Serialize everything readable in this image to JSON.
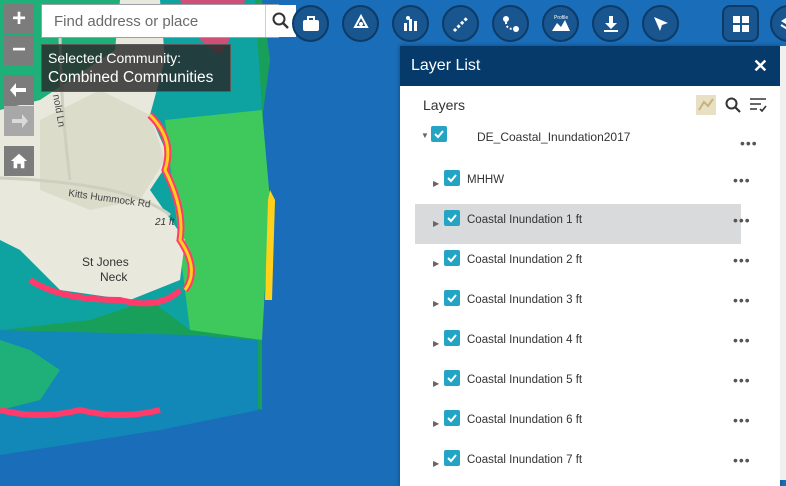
{
  "search": {
    "placeholder": "Find address or place"
  },
  "map_controls": {
    "zoom_in": "+",
    "zoom_out": "−"
  },
  "community": {
    "label": "Selected Community:",
    "value": "Combined Communities"
  },
  "map_labels": {
    "road1": "Kitts Hummock Rd",
    "road2": "21 ft",
    "place": "St Jones",
    "place2": "Neck",
    "side": "nold Ln"
  },
  "panel": {
    "title": "Layer List",
    "close": "✕",
    "layers_heading": "Layers",
    "root_layer": "DE_Coastal_Inundation2017",
    "layers": [
      {
        "label": "MHHW"
      },
      {
        "label": "Coastal Inundation 1 ft"
      },
      {
        "label": "Coastal Inundation 2 ft"
      },
      {
        "label": "Coastal Inundation 3 ft"
      },
      {
        "label": "Coastal Inundation 4 ft"
      },
      {
        "label": "Coastal Inundation 5 ft"
      },
      {
        "label": "Coastal Inundation 6 ft"
      },
      {
        "label": "Coastal Inundation 7 ft"
      }
    ],
    "more": "•••",
    "selected_index": 1
  },
  "toolbar": [
    {
      "name": "briefcase-tool-icon"
    },
    {
      "name": "recycle-tool-icon"
    },
    {
      "name": "chart-tool-icon"
    },
    {
      "name": "measure-tool-icon"
    },
    {
      "name": "directions-tool-icon"
    },
    {
      "name": "profile-tool-icon",
      "label": "Profile"
    },
    {
      "name": "download-tool-icon"
    },
    {
      "name": "select-tool-icon"
    },
    {
      "name": "dashboard-tool-icon"
    },
    {
      "name": "layers-tool-icon"
    }
  ],
  "colors": {
    "water": "#1a6db8",
    "panel_header": "#063a6a",
    "checkbox": "#24a4c4"
  }
}
